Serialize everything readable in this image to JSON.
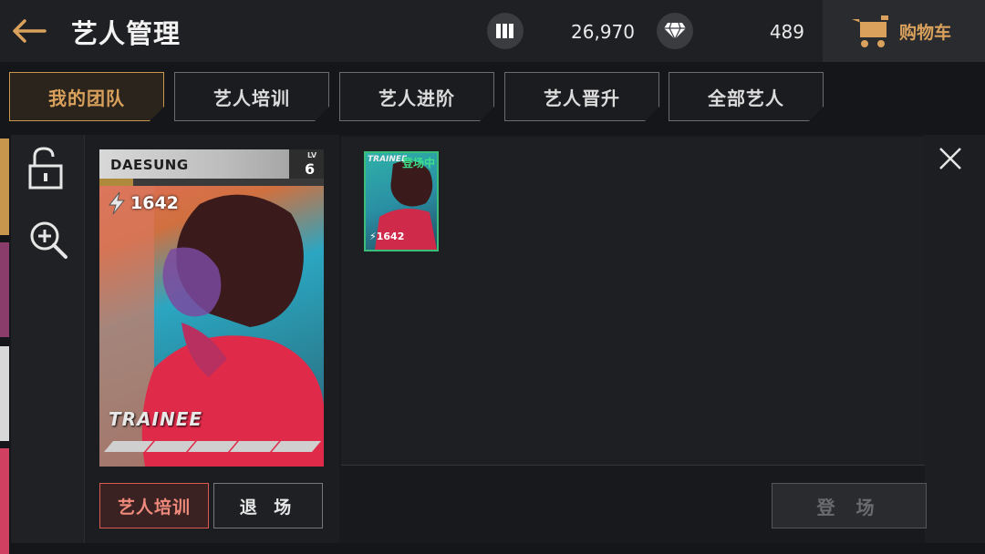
{
  "header": {
    "title": "艺人管理",
    "currency1": {
      "icon": "card-deck-icon",
      "value": "26,970"
    },
    "currency2": {
      "icon": "diamond-icon",
      "value": "489"
    },
    "cart_label": "购物车"
  },
  "tabs": [
    {
      "label": "我的团队",
      "active": true
    },
    {
      "label": "艺人培训",
      "active": false
    },
    {
      "label": "艺人进阶",
      "active": false
    },
    {
      "label": "艺人晋升",
      "active": false
    },
    {
      "label": "全部艺人",
      "active": false
    }
  ],
  "tools": {
    "lock_icon": "unlock-icon",
    "zoom_icon": "zoom-in-icon"
  },
  "card": {
    "name": "DAESUNG",
    "lv_label": "LV",
    "level": "6",
    "power": "1642",
    "grade": "TRAINEE",
    "xp_progress": 0.15,
    "star_segments": 5
  },
  "actions": {
    "train": "艺人培训",
    "leave": "退 场"
  },
  "roster": [
    {
      "badge": "登场中",
      "power": "1642",
      "grade": "TRAINEE"
    }
  ],
  "deploy_label": "登 场",
  "colors": {
    "accent": "#d9a15c",
    "danger": "#d85a50",
    "active_green": "#3bbd7a"
  }
}
